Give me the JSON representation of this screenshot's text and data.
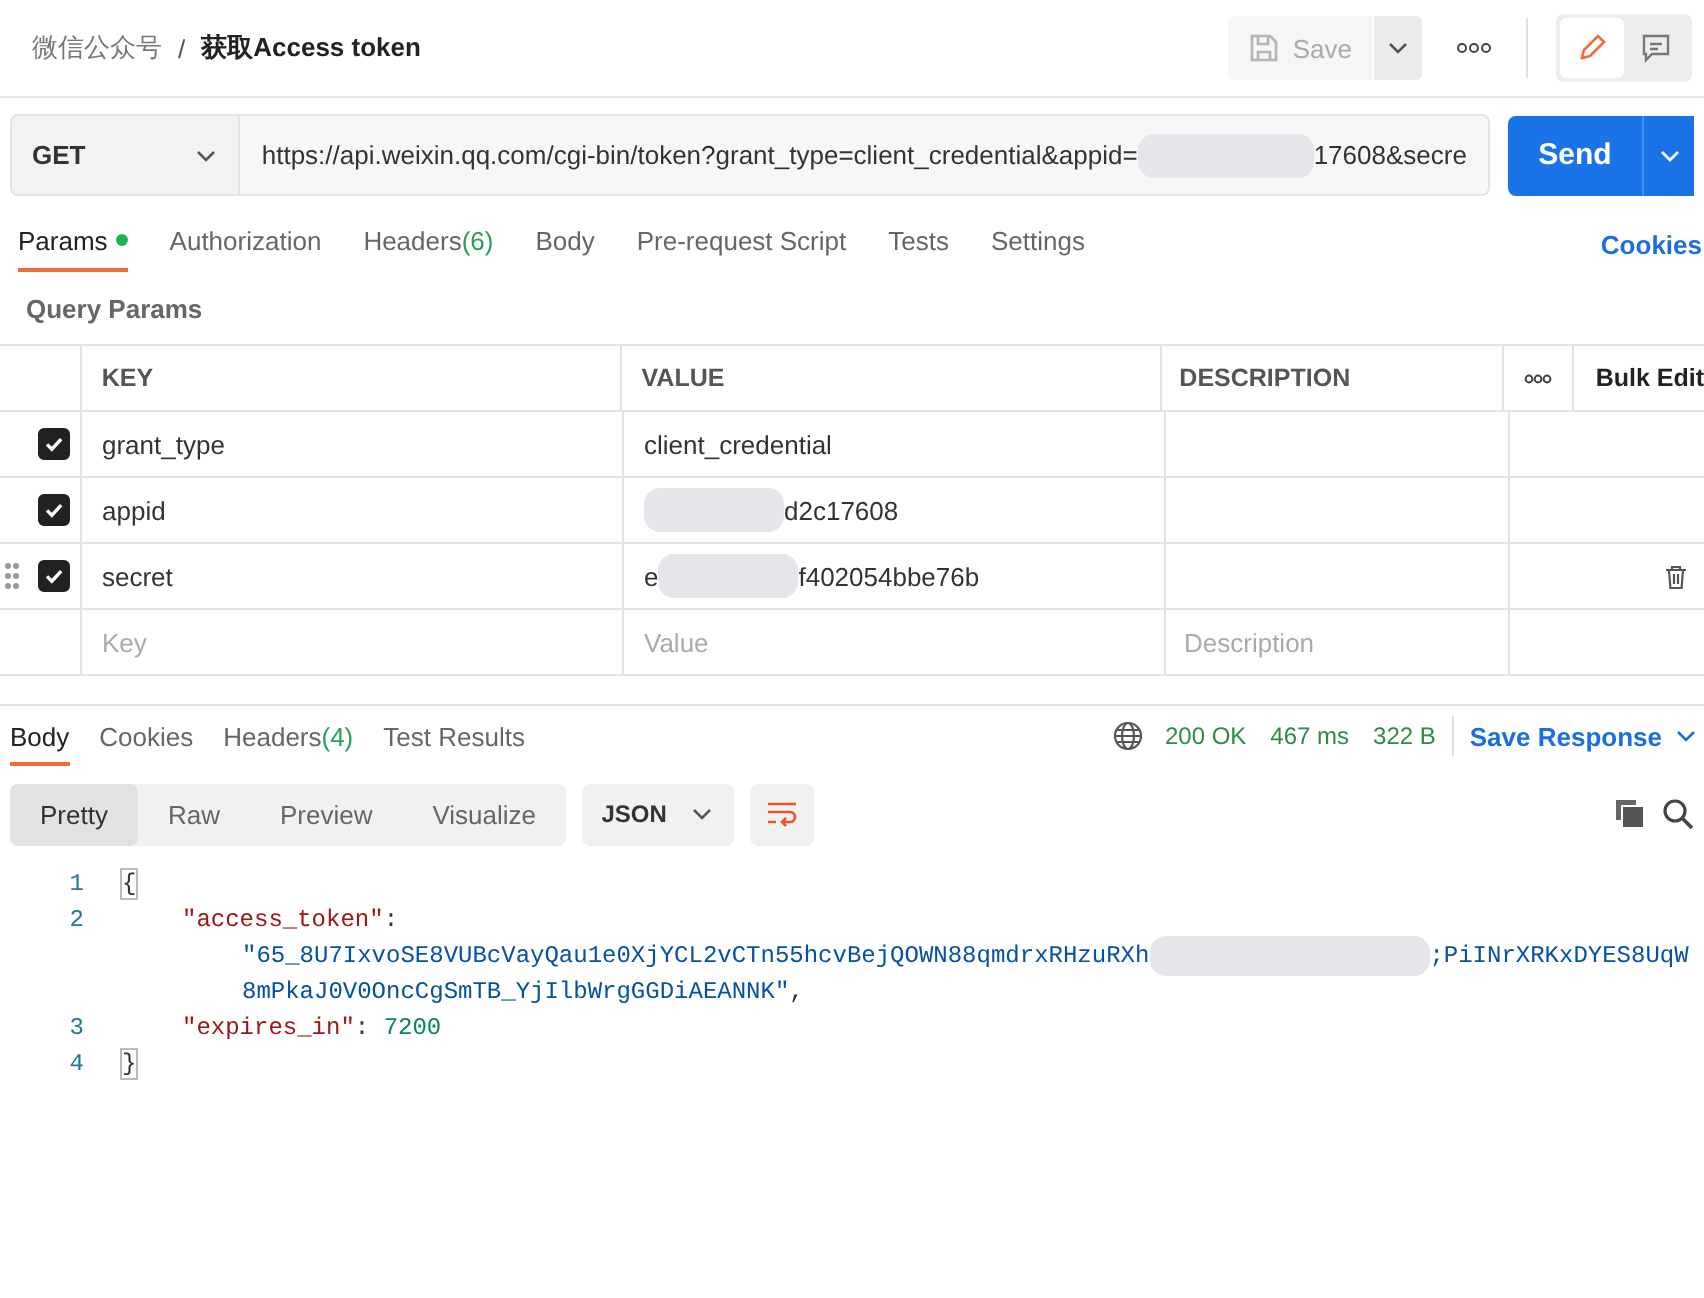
{
  "breadcrumb": {
    "parent": "微信公众号",
    "separator": "/",
    "title": "获取Access token"
  },
  "save_button": "Save",
  "mode_toggle": [
    {
      "kind": "edit",
      "selected": true
    },
    {
      "kind": "comment",
      "selected": false
    }
  ],
  "request": {
    "method": "GET",
    "url": [
      {
        "kind": "text",
        "text": "https://api.weixin.qq.com/cgi-bin/token?grant_type=client_credential&appid="
      },
      {
        "kind": "redaction"
      },
      {
        "kind": "text",
        "text": "17608&secre"
      }
    ],
    "send": "Send"
  },
  "request_tabs": [
    {
      "label": "Params",
      "dot": true,
      "selected": true
    },
    {
      "label": "Authorization",
      "dot": false,
      "selected": false
    },
    {
      "label": "Headers",
      "count": "(6)",
      "dot": false,
      "selected": false
    },
    {
      "label": "Body",
      "dot": false,
      "selected": false
    },
    {
      "label": "Pre-request Script",
      "dot": false,
      "selected": false
    },
    {
      "label": "Tests",
      "dot": false,
      "selected": false
    },
    {
      "label": "Settings",
      "dot": false,
      "selected": false
    }
  ],
  "cookies_link": "Cookies",
  "query_params": {
    "title": "Query Params",
    "columns": [
      "KEY",
      "VALUE",
      "DESCRIPTION"
    ],
    "bulk_edit": "Bulk Edit",
    "rows": [
      {
        "checked": true,
        "hovered": false,
        "key": "grant_type",
        "value": [
          {
            "kind": "text",
            "text": "client_credential"
          }
        ]
      },
      {
        "checked": true,
        "hovered": false,
        "key": "appid",
        "value": [
          {
            "kind": "redaction"
          },
          {
            "kind": "text",
            "text": "d2c17608"
          }
        ]
      },
      {
        "checked": true,
        "hovered": true,
        "key": "secret",
        "value": [
          {
            "kind": "text",
            "text": "e"
          },
          {
            "kind": "redaction"
          },
          {
            "kind": "text",
            "text": "f402054bbe76b"
          }
        ]
      }
    ],
    "placeholders": {
      "key": "Key",
      "value": "Value",
      "description": "Description"
    }
  },
  "response_tabs": [
    {
      "label": "Body",
      "selected": true
    },
    {
      "label": "Cookies",
      "selected": false
    },
    {
      "label": "Headers",
      "count": "(4)",
      "selected": false
    },
    {
      "label": "Test Results",
      "selected": false
    }
  ],
  "status": {
    "code": "200 OK",
    "time": "467 ms",
    "size": "322 B"
  },
  "save_response": "Save Response",
  "view_tabs": [
    {
      "label": "Pretty",
      "selected": true
    },
    {
      "label": "Raw",
      "selected": false
    },
    {
      "label": "Preview",
      "selected": false
    },
    {
      "label": "Visualize",
      "selected": false
    }
  ],
  "format": "JSON",
  "code_lines": [
    {
      "number": "1",
      "kind": "brace",
      "segments": [
        {
          "kind": "brace",
          "text": "{"
        }
      ]
    },
    {
      "number": "2",
      "kind": "member",
      "segments": [
        {
          "kind": "key",
          "text": "\"access_token\""
        },
        {
          "kind": "punct",
          "text": ":"
        }
      ]
    },
    {
      "kind": "wrap",
      "segments": [
        {
          "kind": "string",
          "text": "\"65_8U7IxvoSE8VUBcVayQau1e0XjYCL2vCTn55hcvBejQOWN88qmdrxRHzuRXh"
        },
        {
          "kind": "redaction"
        },
        {
          "kind": "string",
          "text": ";PiINrXRKxDYES8UqW"
        }
      ]
    },
    {
      "kind": "wrap",
      "segments": [
        {
          "kind": "string",
          "text": "8mPkaJ0V0OncCgSmTB_YjIlbWrgGGDiAEANNK\""
        },
        {
          "kind": "punct",
          "text": ","
        }
      ]
    },
    {
      "number": "3",
      "kind": "member",
      "segments": [
        {
          "kind": "key",
          "text": "\"expires_in\""
        },
        {
          "kind": "punct",
          "text": ": "
        },
        {
          "kind": "number",
          "text": "7200"
        }
      ]
    },
    {
      "number": "4",
      "kind": "brace",
      "segments": [
        {
          "kind": "brace",
          "text": "}"
        }
      ]
    }
  ]
}
